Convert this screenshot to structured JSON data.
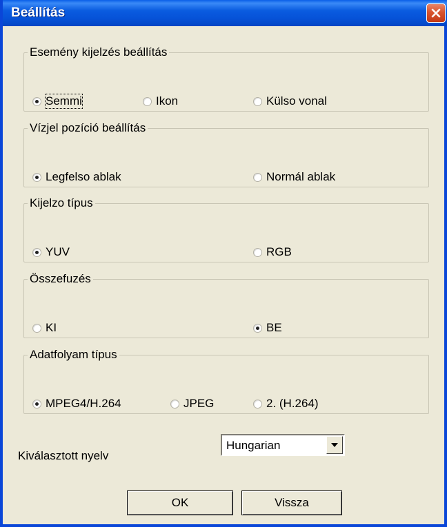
{
  "window": {
    "title": "Beállítás"
  },
  "groups": {
    "event_display": {
      "legend": "Esemény kijelzés beállítás",
      "options": [
        "Semmi",
        "Ikon",
        "Külso vonal"
      ],
      "selected": "Semmi"
    },
    "watermark_position": {
      "legend": "Vízjel pozíció beállítás",
      "options": [
        "Legfelso ablak",
        "Normál ablak"
      ],
      "selected": "Legfelso ablak"
    },
    "display_type": {
      "legend": "Kijelzo típus",
      "options": [
        "YUV",
        "RGB"
      ],
      "selected": "YUV"
    },
    "merge": {
      "legend": "Összefuzés",
      "options": [
        "KI",
        "BE"
      ],
      "selected": "BE"
    },
    "stream_type": {
      "legend": "Adatfolyam típus",
      "options": [
        "MPEG4/H.264",
        "JPEG",
        "2. (H.264)"
      ],
      "selected": "MPEG4/H.264"
    }
  },
  "language": {
    "label": "Kiválasztott nyelv",
    "selected": "Hungarian"
  },
  "buttons": {
    "ok": "OK",
    "back": "Vissza"
  },
  "colors": {
    "titlebar": "#0a5ce0",
    "dialog_bg": "#ece9d8",
    "close_button": "#d8542e"
  }
}
